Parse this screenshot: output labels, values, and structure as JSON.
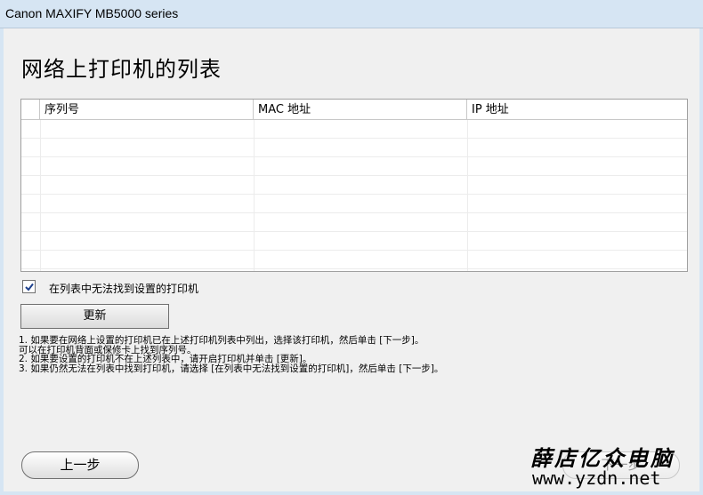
{
  "window": {
    "title": "Canon MAXIFY MB5000 series"
  },
  "page": {
    "heading": "网络上打印机的列表"
  },
  "table": {
    "columns": [
      "序列号",
      "MAC 地址",
      "IP 地址"
    ],
    "rows": []
  },
  "checkbox": {
    "label": "在列表中无法找到设置的打印机",
    "checked": true
  },
  "buttons": {
    "refresh": "更新",
    "back": "上一步",
    "next": "下一步"
  },
  "notes": [
    "1.  如果要在网络上设置的打印机已在上述打印机列表中列出，选择该打印机，然后单击 [下一步]。",
    "可以在打印机背面或保修卡上找到序列号。",
    "2.  如果要设置的打印机不在上述列表中，请开启打印机并单击 [更新]。",
    "3.  如果仍然无法在列表中找到打印机，请选择 [在列表中无法找到设置的打印机]，然后单击 [下一步]。"
  ],
  "watermark": {
    "title": "薛店亿众电脑",
    "url": "www.yzdn.net"
  }
}
